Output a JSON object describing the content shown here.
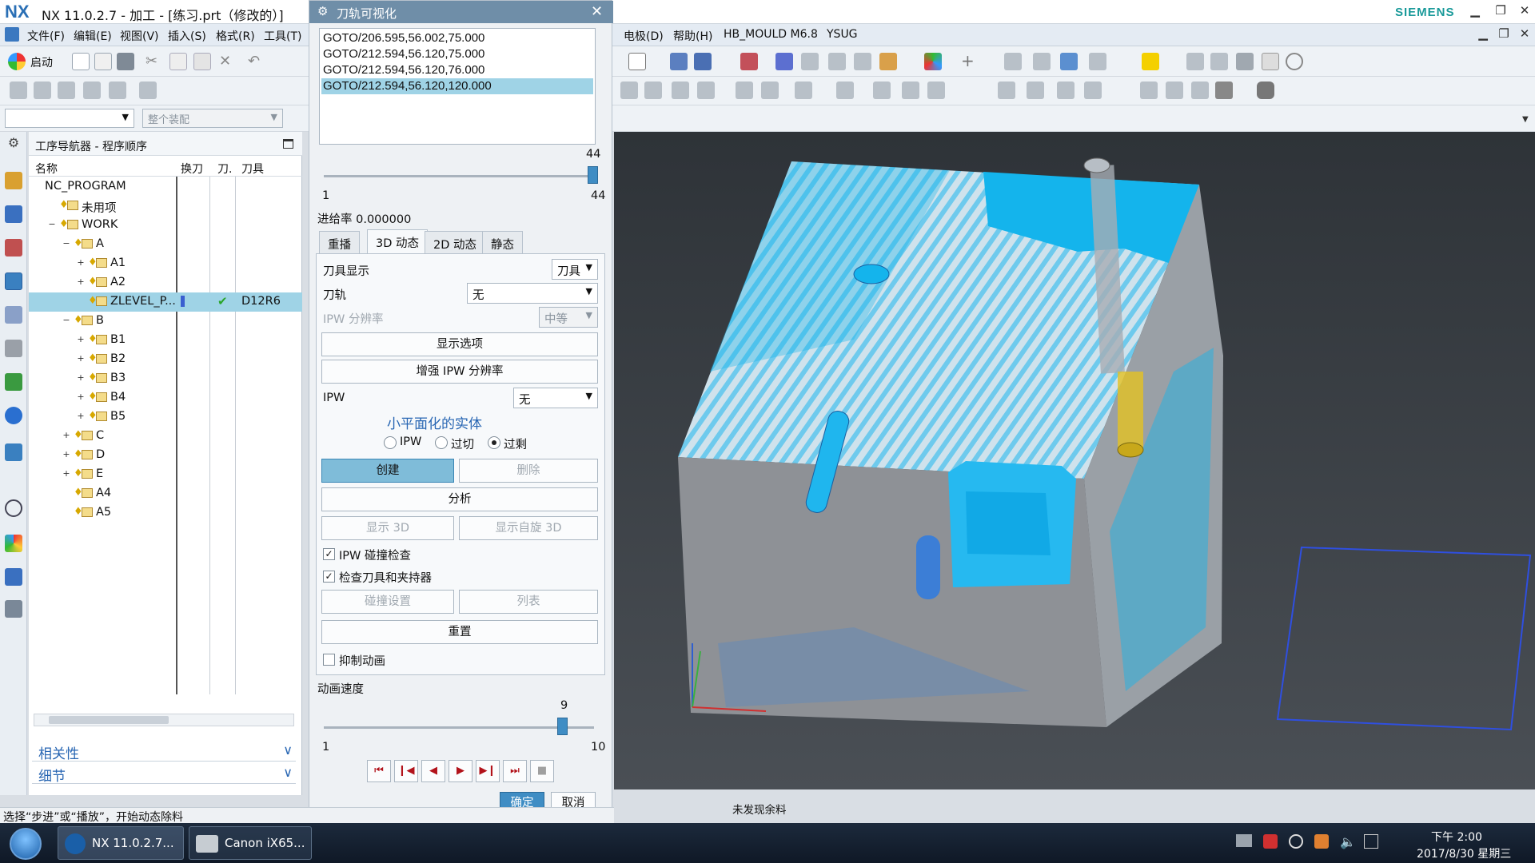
{
  "window": {
    "logo": "NX",
    "title": "NX 11.0.2.7 - 加工 - [练习.prt（修改的）]",
    "brand": "SIEMENS"
  },
  "menu": [
    "文件(F)",
    "编辑(E)",
    "视图(V)",
    "插入(S)",
    "格式(R)",
    "工具(T)"
  ],
  "menu_right": [
    "电极(D)",
    "帮助(H)",
    "HB_MOULD M6.8",
    "YSUG"
  ],
  "toolbar": {
    "start_label": "启动",
    "assembly_filter_placeholder": "整个装配"
  },
  "navigator": {
    "title": "工序导航器 - 程序顺序",
    "columns": [
      "名称",
      "换刀",
      "刀.",
      "刀具"
    ],
    "rows": [
      {
        "label": "NC_PROGRAM",
        "level": 0,
        "toggle": "",
        "icon": false
      },
      {
        "label": "未用项",
        "level": 1,
        "toggle": "",
        "icon": true
      },
      {
        "label": "WORK",
        "level": 1,
        "toggle": "−",
        "icon": true
      },
      {
        "label": "A",
        "level": 2,
        "toggle": "−",
        "icon": true
      },
      {
        "label": "A1",
        "level": 3,
        "toggle": "+",
        "icon": true
      },
      {
        "label": "A2",
        "level": 3,
        "toggle": "+",
        "icon": true
      },
      {
        "label": "ZLEVEL_P...",
        "level": 3,
        "toggle": "",
        "icon": true,
        "selected": true,
        "tool": "D12R6",
        "changed": true
      },
      {
        "label": "B",
        "level": 2,
        "toggle": "−",
        "icon": true
      },
      {
        "label": "B1",
        "level": 3,
        "toggle": "+",
        "icon": true
      },
      {
        "label": "B2",
        "level": 3,
        "toggle": "+",
        "icon": true
      },
      {
        "label": "B3",
        "level": 3,
        "toggle": "+",
        "icon": true
      },
      {
        "label": "B4",
        "level": 3,
        "toggle": "+",
        "icon": true
      },
      {
        "label": "B5",
        "level": 3,
        "toggle": "+",
        "icon": true
      },
      {
        "label": "C",
        "level": 2,
        "toggle": "+",
        "icon": true
      },
      {
        "label": "D",
        "level": 2,
        "toggle": "+",
        "icon": true
      },
      {
        "label": "E",
        "level": 2,
        "toggle": "+",
        "icon": true
      },
      {
        "label": "A4",
        "level": 2,
        "toggle": "",
        "icon": true
      },
      {
        "label": "A5",
        "level": 2,
        "toggle": "",
        "icon": true
      }
    ],
    "sections": [
      "相关性",
      "细节"
    ]
  },
  "dialog": {
    "title": "刀轨可视化",
    "goto_lines": [
      "GOTO/206.595,56.002,75.000",
      "GOTO/212.594,56.120,75.000",
      "GOTO/212.594,56.120,76.000",
      "GOTO/212.594,56.120,120.000"
    ],
    "step_value": "44",
    "step_min": "1",
    "step_max": "44",
    "feed_rate": "进给率 0.000000",
    "tabs": [
      "重播",
      "3D 动态",
      "2D 动态",
      "静态"
    ],
    "active_tab": 1,
    "tool_display_label": "刀具显示",
    "tool_display_value": "刀具",
    "path_label": "刀轨",
    "path_value": "无",
    "ipw_res_label": "IPW 分辨率",
    "ipw_res_value": "中等",
    "btn_display_options": "显示选项",
    "btn_enhance": "增强 IPW 分辨率",
    "ipw_label": "IPW",
    "ipw_value": "无",
    "facet_title": "小平面化的实体",
    "radio_ipw": "IPW",
    "radio_overcut": "过切",
    "radio_excess": "过剩",
    "btn_create": "创建",
    "btn_delete": "删除",
    "btn_analyze": "分析",
    "btn_show3d": "显示 3D",
    "btn_show_rotate": "显示自旋 3D",
    "chk_collision": "IPW 碰撞检查",
    "chk_tool_holder": "检查刀具和夹持器",
    "btn_collision_settings": "碰撞设置",
    "btn_list": "列表",
    "btn_reset": "重置",
    "chk_suppress": "抑制动画",
    "speed_label": "动画速度",
    "speed_value": "9",
    "speed_min": "1",
    "speed_max": "10",
    "ok": "确定",
    "cancel": "取消"
  },
  "viewport": {
    "status_message": "未发现余料"
  },
  "statusbar": {
    "prompt": "选择“步进”或“播放”，开始动态除料"
  },
  "taskbar": {
    "apps": [
      "NX 11.0.2.7...",
      "Canon iX65..."
    ],
    "time": "下午 2:00",
    "date": "2017/8/30 星期三"
  },
  "colors": {
    "accent": "#3f8dc4",
    "selection": "#9fd3e6",
    "stock_cyan": "#14b4ec",
    "viewport_bg": "#3a3f44"
  }
}
